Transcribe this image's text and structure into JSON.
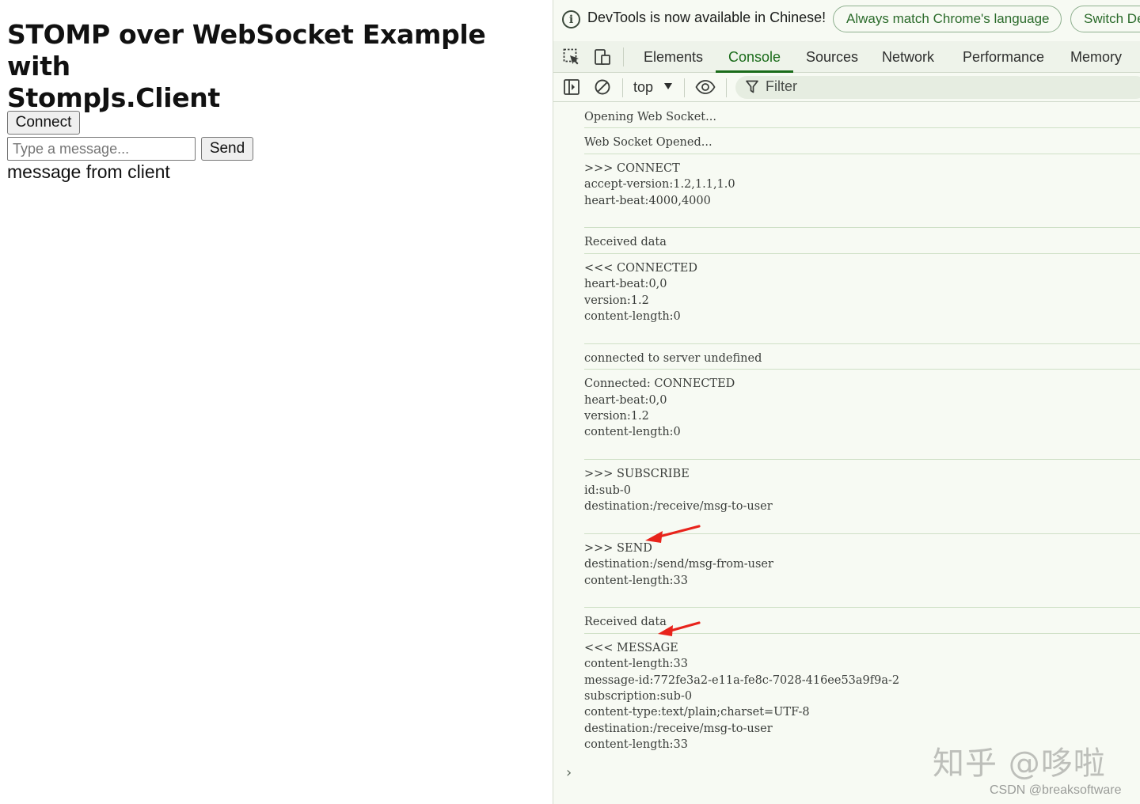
{
  "page": {
    "title_line1": "STOMP over WebSocket Example with",
    "title_line2": "StompJs.Client",
    "connect_label": "Connect",
    "input_placeholder": "Type a message...",
    "input_value": "",
    "send_label": "Send",
    "received_message": "message from client"
  },
  "devtools": {
    "infobar": {
      "text": "DevTools is now available in Chinese!",
      "match_language_label": "Always match Chrome's language",
      "switch_label": "Switch De"
    },
    "tabs": [
      {
        "label": "Elements"
      },
      {
        "label": "Console",
        "active": true
      },
      {
        "label": "Sources"
      },
      {
        "label": "Network"
      },
      {
        "label": "Performance"
      },
      {
        "label": "Memory"
      }
    ],
    "toolbar": {
      "context": "top",
      "filter_placeholder": "Filter"
    },
    "console_entries": [
      [
        "Opening Web Socket..."
      ],
      [
        "Web Socket Opened..."
      ],
      [
        ">>> CONNECT",
        "accept-version:1.2,1.1,1.0",
        "heart-beat:4000,4000",
        ""
      ],
      [
        "Received data"
      ],
      [
        "<<< CONNECTED",
        "heart-beat:0,0",
        "version:1.2",
        "content-length:0",
        ""
      ],
      [
        "connected to server undefined"
      ],
      [
        "Connected: CONNECTED",
        "heart-beat:0,0",
        "version:1.2",
        "content-length:0",
        ""
      ],
      [
        ">>> SUBSCRIBE",
        "id:sub-0",
        "destination:/receive/msg-to-user",
        ""
      ],
      [
        ">>> SEND",
        "destination:/send/msg-from-user",
        "content-length:33",
        ""
      ],
      [
        "Received data"
      ],
      [
        "<<< MESSAGE",
        "content-length:33",
        "message-id:772fe3a2-e11a-fe8c-7028-416ee53a9f9a-2",
        "subscription:sub-0",
        "content-type:text/plain;charset=UTF-8",
        "destination:/receive/msg-to-user",
        "content-length:33"
      ]
    ],
    "prompt_symbol": "›",
    "annotation_color": "#e8231b"
  },
  "watermarks": {
    "zhihu": "知乎 @哆啦",
    "csdn": "CSDN @breaksoftware"
  }
}
